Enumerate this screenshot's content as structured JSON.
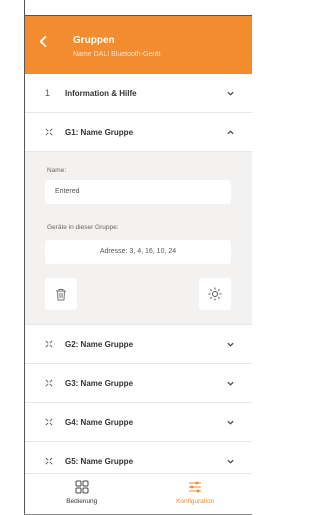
{
  "header": {
    "title": "Gruppen",
    "subtitle": "Name DALI Bluetooth-Gerät"
  },
  "rows": [
    {
      "lead": "1",
      "label": "Information & Hilfe"
    },
    {
      "lead": "icon",
      "label": "G1: Name Gruppe"
    }
  ],
  "expanded": {
    "name_label": "Name:",
    "name_value": "Entered",
    "devices_label": "Geräte in dieser Gruppe:",
    "devices_value": "Adresse: 3, 4, 16, 10, 24"
  },
  "more_rows": [
    {
      "label": "G2: Name Gruppe"
    },
    {
      "label": "G3: Name Gruppe"
    },
    {
      "label": "G4: Name Gruppe"
    },
    {
      "label": "G5: Name Gruppe"
    }
  ],
  "tabs": {
    "operation": "Bedienung",
    "configuration": "Konfiguration"
  },
  "colors": {
    "accent": "#f28c2e"
  }
}
